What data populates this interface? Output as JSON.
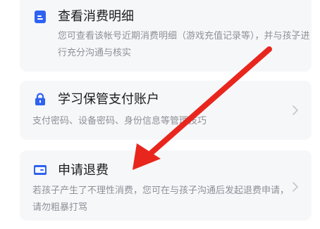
{
  "cards": [
    {
      "title": "查看消费明细",
      "description": "您可查看该帐号近期消费明细（游戏充值记录等），并与孩子进行充分沟通与核实",
      "icon": "document-icon"
    },
    {
      "title": "学习保管支付账户",
      "description": "支付密码、设备密码、身份信息等管理技巧",
      "icon": "lock-icon"
    },
    {
      "title": "申请退费",
      "description": "若孩子产生了不理性消费，您可在与孩子沟通后发起退费申请，请勿粗暴打骂",
      "icon": "wallet-icon"
    }
  ],
  "colors": {
    "accent": "#2f62f2",
    "card_bg": "#f6f7f9",
    "title_text": "#1b1b1f",
    "desc_text": "#8e9096",
    "annotation_arrow": "#e8261d"
  }
}
